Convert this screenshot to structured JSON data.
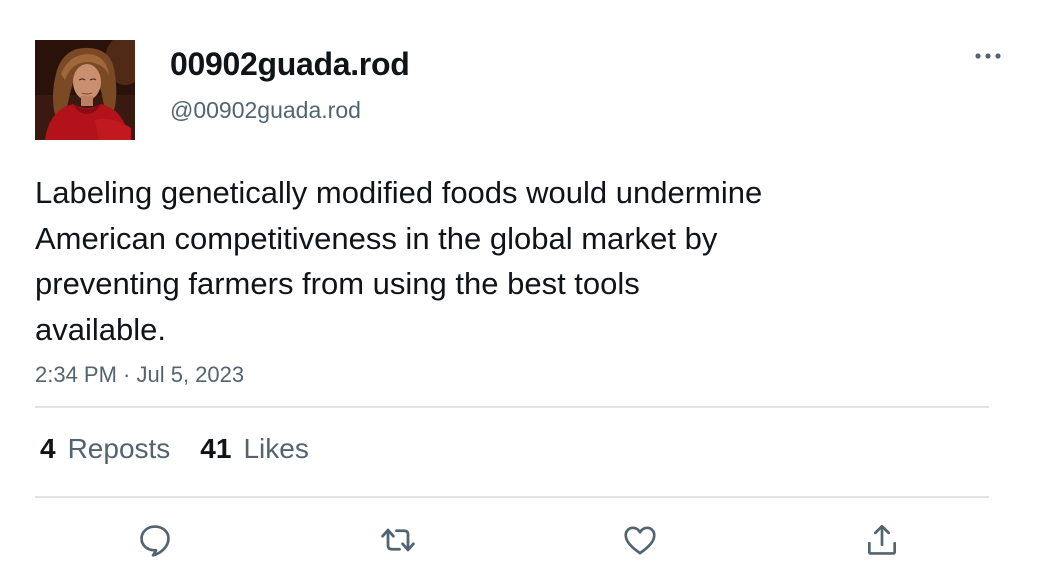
{
  "tweet": {
    "author": {
      "display_name": "00902guada.rod",
      "handle": "@00902guada.rod",
      "avatar": "profile-photo"
    },
    "text_lines": [
      "Labeling genetically modified foods would undermine",
      "American competitiveness in the global market by",
      "preventing farmers from using the best tools",
      "available."
    ],
    "timestamp": "2:34 PM · Jul 5, 2023",
    "stats": {
      "reposts_count": "4",
      "reposts_label": "Reposts",
      "likes_count": "41",
      "likes_label": "Likes"
    },
    "actions": {
      "reply": "reply-icon",
      "repost": "repost-icon",
      "like": "like-icon",
      "share": "share-icon"
    },
    "more_menu": "more-icon"
  },
  "colors": {
    "text_primary": "#0f1419",
    "text_secondary": "#536471",
    "divider": "#e1e4e8",
    "icon": "#536471"
  }
}
